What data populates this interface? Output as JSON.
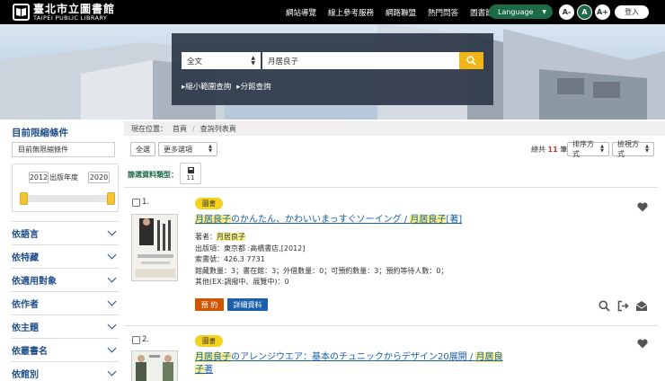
{
  "header": {
    "logo_zh": "臺北市立圖書館",
    "logo_en": "TAIPEI PUBLIC LIBRARY",
    "nav": [
      "網站導覽",
      "線上參考服務",
      "網路聯盟",
      "熱門問答",
      "圖書館首頁"
    ],
    "language": "Language",
    "font_buttons": [
      "A-",
      "A",
      "A+"
    ],
    "login": "登入"
  },
  "search": {
    "field": "全文",
    "query": "月居良子",
    "links": [
      "縮小範圍查詢",
      "分館查詢"
    ]
  },
  "sidebar": {
    "title": "目前限縮條件",
    "no_filter": "目前無限縮條件",
    "year_from": "2012",
    "year_label": "出版年度",
    "year_to": "2020",
    "facets": [
      "依語言",
      "依特藏",
      "依適用對象",
      "依作者",
      "依主題",
      "依叢書名",
      "依館別"
    ]
  },
  "breadcrumb": {
    "label": "現在位置：",
    "items": [
      "首頁",
      "查詢列表頁"
    ]
  },
  "toolbar": {
    "select_all": "全選",
    "more": "更多選項",
    "total_prefix": "總共",
    "total": "11",
    "total_suffix": "筆",
    "sort": "排序方式",
    "view": "檢視方式"
  },
  "filter": {
    "label": "篩選資料類型：",
    "count": "11"
  },
  "results": [
    {
      "index": "1.",
      "type": "圖書",
      "title_hl1": "月居良子",
      "title_mid": "のかんたん、かわいいまっすぐソーイング / ",
      "title_hl2": "月居良子",
      "title_end": "[著]",
      "author_label": "著者：",
      "author": "月居良子",
      "publication": "出版項：東京都 :高橋書店,[2012]",
      "call_no": "索書號：426.3 7731",
      "holdings": "館藏數量：3；書在館：3；外借數量：0；可預約數量：3；預約等待人數：0；",
      "other": "其他(EX:調撥中、展覽中)：0",
      "reserve": "預 約",
      "details": "詳細資料"
    },
    {
      "index": "2.",
      "type": "圖書",
      "title_hl1": "月居良子",
      "title_mid": "のアレンジウエア：基本のチュニックからデザイン20展開 / ",
      "title_hl2": "月居良",
      "title_hl3": "子",
      "title_end": "著"
    }
  ],
  "colors": {
    "accent": "#f2b518",
    "brand_green": "#1b6b46",
    "link": "#1a5fa8",
    "reserve": "#d35400",
    "details": "#1a5fa8"
  }
}
